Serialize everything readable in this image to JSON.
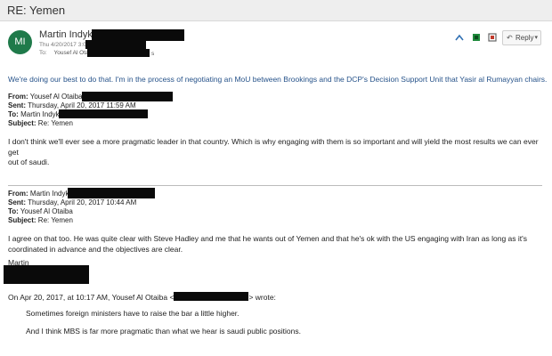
{
  "subject": "RE: Yemen",
  "header": {
    "avatar_initials": "MI",
    "from_name": "Martin Indyk",
    "date": "Thu 4/20/2017 3:04 PM",
    "to_label": "To:",
    "to_name": "Yousef Al Otaiba",
    "to_suffix": "s",
    "reply_label": "Reply",
    "colors": {
      "avatar": "#1f7a4a",
      "accent": "#27538a"
    }
  },
  "actions": {
    "icons": [
      "reply-arrow-icon",
      "flag-icon",
      "category-icon",
      "reply-icon",
      "chevron-down-icon"
    ]
  },
  "top_message": "We're doing our best to do that.  I'm in the process of negotiating an MoU between Brookings and the DCP's Decision Support Unit that Yasir al Rumayyan chairs.",
  "email1": {
    "from_label": "From:",
    "from": "Yousef Al Otaiba",
    "sent_label": "Sent:",
    "sent": "Thursday, April 20, 2017 11:59 AM",
    "to_label": "To:",
    "to": "Martin Indyk",
    "subject_label": "Subject:",
    "subject": "Re: Yemen",
    "body_line1": "I don't think we'll ever see a more pragmatic leader in that country.  Which is why engaging with them is so important and will yield the most results we can ever get",
    "body_line2": "out of saudi."
  },
  "email2": {
    "from_label": "From:",
    "from": "Martin Indyk",
    "sent_label": "Sent:",
    "sent": "Thursday, April 20, 2017 10:44 AM",
    "to_label": "To:",
    "to": "Yousef Al Otaiba",
    "subject_label": "Subject:",
    "subject": "Re: Yemen",
    "body_line1": "I agree on that too.  He was quite clear with Steve Hadley and me that he wants out of Yemen and that he's ok with the US engaging with Iran as long as it's",
    "body_line2": "coordinated in advance and the objectives are clear.",
    "signature": "Martin"
  },
  "quoted": {
    "intro_start": "On Apr 20, 2017, at 10:17 AM, Yousef Al Otaiba <",
    "intro_end": "> wrote:",
    "line1": "Sometimes foreign ministers have to raise the bar a little higher.",
    "line2": "And I think MBS is far more pragmatic than what we hear is saudi public positions."
  }
}
